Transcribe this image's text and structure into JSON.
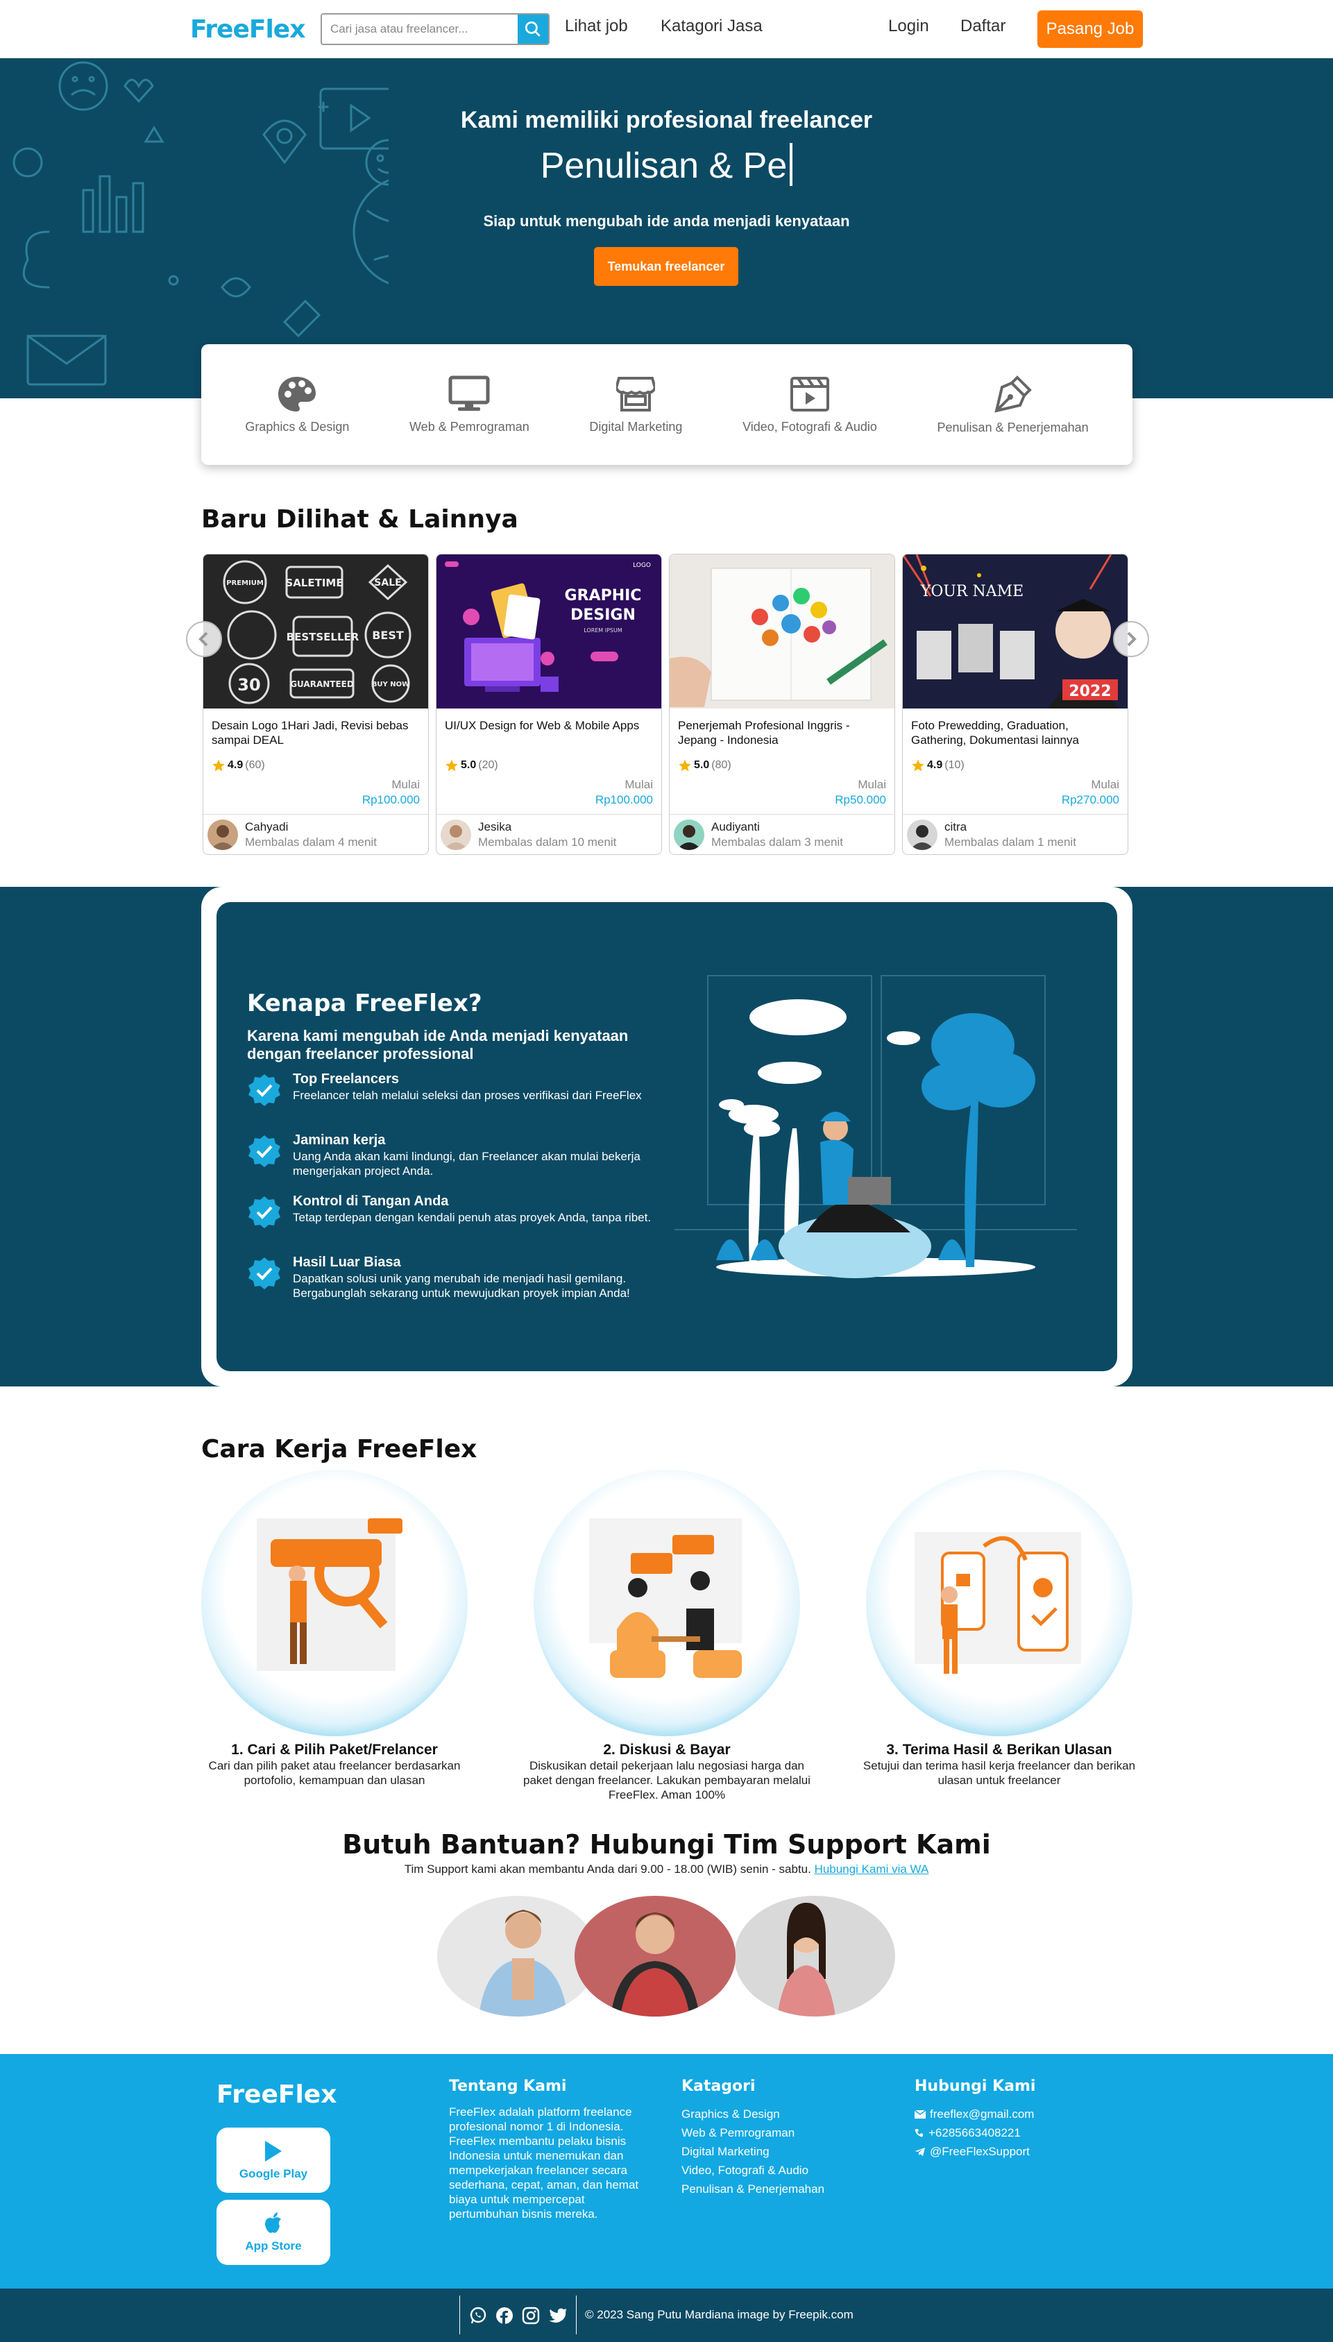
{
  "nav": {
    "logo": "FreeFlex",
    "search_placeholder": "Cari jasa atau freelancer...",
    "links": [
      "Lihat job",
      "Katagori Jasa"
    ],
    "login": "Login",
    "daftar": "Daftar",
    "pasang": "Pasang Job"
  },
  "hero": {
    "subtitle": "Kami memiliki profesional freelancer",
    "typed": "Penulisan & Pe",
    "desc": "Siap untuk mengubah ide anda menjadi kenyataan",
    "button": "Temukan freelancer"
  },
  "categories": [
    {
      "label": "Graphics & Design",
      "icon": "palette-icon"
    },
    {
      "label": "Web & Pemrograman",
      "icon": "monitor-icon"
    },
    {
      "label": "Digital Marketing",
      "icon": "store-icon"
    },
    {
      "label": "Video, Fotografi & Audio",
      "icon": "film-icon"
    },
    {
      "label": "Penulisan & Penerjemahan",
      "icon": "pen-nib-icon"
    }
  ],
  "recent": {
    "title": "Baru Dilihat & Lainnya",
    "cards": [
      {
        "title": "Desain Logo 1Hari Jadi, Revisi bebas sampai DEAL",
        "rating": "4.9",
        "count": "(60)",
        "mulai": "Mulai",
        "price": "Rp100.000",
        "user": "Cahyadi",
        "resp": "Membalas dalam 4 menit"
      },
      {
        "title": "UI/UX Design for Web & Mobile Apps",
        "rating": "5.0",
        "count": "(20)",
        "mulai": "Mulai",
        "price": "Rp100.000",
        "user": "Jesika",
        "resp": "Membalas dalam 10 menit"
      },
      {
        "title": "Penerjemah Profesional Inggris - Jepang - Indonesia",
        "rating": "5.0",
        "count": "(80)",
        "mulai": "Mulai",
        "price": "Rp50.000",
        "user": "Audiyanti",
        "resp": "Membalas dalam 3 menit"
      },
      {
        "title": "Foto Prewedding, Graduation, Gathering, Dokumentasi lainnya",
        "rating": "4.9",
        "count": "(10)",
        "mulai": "Mulai",
        "price": "Rp270.000",
        "user": "citra",
        "resp": "Membalas dalam 1 menit"
      }
    ],
    "thumb_text": {
      "logo_badges": [
        "PREMIUM",
        "SALETIME",
        "SALE",
        "BESTSELLER",
        "BEST",
        "30",
        "GUARANTEED",
        "BUY NOW"
      ],
      "graphic": [
        "GRAPHIC",
        "DESIGN",
        "LOREM IPSUM",
        "LOGO"
      ],
      "grad": [
        "YOUR NAME",
        "2022"
      ]
    }
  },
  "why": {
    "title": "Kenapa FreeFlex?",
    "subtitle": "Karena kami mengubah ide Anda menjadi kenyataan dengan freelancer professional",
    "features": [
      {
        "title": "Top Freelancers",
        "desc": "Freelancer telah melalui seleksi dan proses verifikasi dari FreeFlex"
      },
      {
        "title": "Jaminan kerja",
        "desc": "Uang Anda akan kami lindungi, dan Freelancer akan mulai bekerja mengerjakan project Anda."
      },
      {
        "title": "Kontrol di Tangan Anda",
        "desc": "Tetap terdepan dengan kendali penuh atas proyek Anda, tanpa ribet."
      },
      {
        "title": "Hasil Luar Biasa",
        "desc": "Dapatkan solusi unik yang merubah ide menjadi hasil gemilang. Bergabunglah sekarang untuk mewujudkan proyek impian Anda!"
      }
    ]
  },
  "how": {
    "title": "Cara Kerja FreeFlex",
    "steps": [
      {
        "title": "1. Cari & Pilih Paket/Frelancer",
        "desc": "Cari dan pilih paket atau freelancer berdasarkan portofolio, kemampuan dan ulasan"
      },
      {
        "title": "2. Diskusi & Bayar",
        "desc": "Diskusikan detail pekerjaan lalu negosiasi harga dan paket dengan freelancer. Lakukan pembayaran melalui FreeFlex. Aman 100%"
      },
      {
        "title": "3. Terima Hasil & Berikan Ulasan",
        "desc": "Setujui dan terima hasil kerja freelancer dan berikan ulasan untuk freelancer"
      }
    ]
  },
  "support": {
    "title": "Butuh Bantuan? Hubungi Tim Support Kami",
    "desc": "Tim Support kami akan membantu Anda dari 9.00 - 18.00 (WIB) senin - sabtu.",
    "link": "Hubungi Kami via WA"
  },
  "footer": {
    "logo": "FreeFlex",
    "google_play": "Google Play",
    "app_store": "App Store",
    "about_title": "Tentang Kami",
    "about": "FreeFlex adalah platform freelance profesional nomor 1 di Indonesia. FreeFlex membantu pelaku bisnis Indonesia untuk menemukan dan mempekerjakan freelancer secara sederhana, cepat, aman, dan hemat biaya untuk mempercepat pertumbuhan bisnis mereka.",
    "cat_title": "Katagori",
    "cats": [
      "Graphics & Design",
      "Web & Pemrograman",
      "Digital Marketing",
      "Video, Fotografi & Audio",
      "Penulisan & Penerjemahan"
    ],
    "contact_title": "Hubungi Kami",
    "email": "freeflex@gmail.com",
    "phone": "+6285663408221",
    "telegram": "@FreeFlexSupport",
    "copyright": "© 2023 Sang Putu Mardiana image by Freepik.com"
  },
  "colors": {
    "brand": "#1aa9dc",
    "dark": "#0c4a63",
    "accent": "#ff7a06",
    "footer": "#13a8e2"
  }
}
